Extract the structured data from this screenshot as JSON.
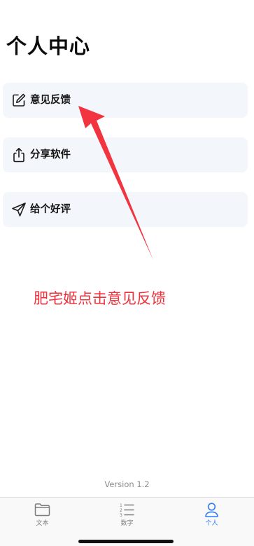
{
  "header": {
    "title": "个人中心"
  },
  "menu": {
    "items": [
      {
        "label": "意见反馈",
        "icon": "edit-icon"
      },
      {
        "label": "分享软件",
        "icon": "share-icon"
      },
      {
        "label": "给个好评",
        "icon": "send-icon"
      }
    ]
  },
  "annotation": {
    "text": "肥宅姬点击意见反馈",
    "color": "#f0303a"
  },
  "footer": {
    "version": "Version 1.2"
  },
  "tabbar": {
    "tabs": [
      {
        "label": "文本",
        "icon": "folder-icon",
        "active": false
      },
      {
        "label": "数字",
        "icon": "numbered-list-icon",
        "active": false
      },
      {
        "label": "个人",
        "icon": "person-icon",
        "active": true
      }
    ],
    "active_color": "#2f7cf6",
    "inactive_color": "#7d7d7d"
  }
}
